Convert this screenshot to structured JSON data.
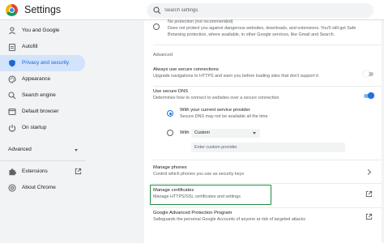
{
  "app": {
    "title": "Settings"
  },
  "search": {
    "placeholder": "Search settings"
  },
  "sidebar": {
    "items": [
      {
        "label": "You and Google",
        "icon": "person-icon"
      },
      {
        "label": "Autofill",
        "icon": "clipboard-icon"
      },
      {
        "label": "Privacy and security",
        "icon": "shield-icon",
        "active": true
      },
      {
        "label": "Appearance",
        "icon": "palette-icon"
      },
      {
        "label": "Search engine",
        "icon": "search-icon"
      },
      {
        "label": "Default browser",
        "icon": "browser-icon"
      },
      {
        "label": "On startup",
        "icon": "power-icon"
      }
    ],
    "advanced_label": "Advanced",
    "extensions_label": "Extensions",
    "about_label": "About Chrome"
  },
  "main": {
    "no_protection": {
      "title": "No protection (not recommended)",
      "desc_line1": "Does not protect you against dangerous websites, downloads, and extensions. You'll still get Safe",
      "desc_line2": "Browsing protection, where available, in other Google services, like Gmail and Search."
    },
    "advanced_heading": "Advanced",
    "https": {
      "title": "Always use secure connections",
      "desc": "Upgrade navigations to HTTPS and warn you before loading sites that don't support it",
      "enabled": false
    },
    "secure_dns": {
      "title": "Use secure DNS",
      "desc": "Determines how to connect to websites over a secure connection",
      "enabled": true,
      "current_provider_title": "With your current service provider",
      "current_provider_desc": "Secure DNS may not be available all the time",
      "with_label": "With",
      "select_value": "Custom",
      "custom_placeholder": "Enter custom provider"
    },
    "manage_phones": {
      "title": "Manage phones",
      "desc": "Control which phones you use as security keys"
    },
    "manage_certificates": {
      "title": "Manage certificates",
      "desc": "Manage HTTPS/SSL certificates and settings"
    },
    "advanced_protection": {
      "title": "Google Advanced Protection Program",
      "desc": "Safeguards the personal Google Accounts of anyone at risk of targeted attacks"
    }
  },
  "colors": {
    "accent": "#1a73e8",
    "active_nav_bg": "#d2e3fc",
    "highlight_border": "#1e8e3e"
  }
}
